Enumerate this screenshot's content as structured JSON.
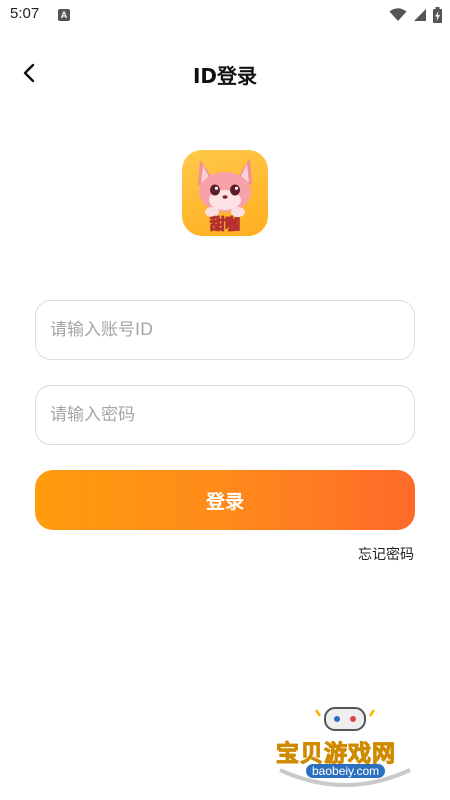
{
  "status_bar": {
    "time": "5:07",
    "notification_glyph": "A"
  },
  "header": {
    "title": "ID登录"
  },
  "logo": {
    "text": "甜咖"
  },
  "form": {
    "account_placeholder": "请输入账号ID",
    "password_placeholder": "请输入密码",
    "login_label": "登录",
    "forgot_label": "忘记密码"
  },
  "watermark": {
    "text": "宝贝游戏网",
    "url": "baobeiy.com"
  },
  "colors": {
    "button_gradient_start": "#ff9d0e",
    "button_gradient_end": "#ff6a2b",
    "logo_bg": "#ffb627"
  },
  "icons": {
    "back": "chevron-left-icon",
    "wifi": "wifi-icon",
    "signal": "signal-icon",
    "battery": "battery-charging-icon"
  }
}
